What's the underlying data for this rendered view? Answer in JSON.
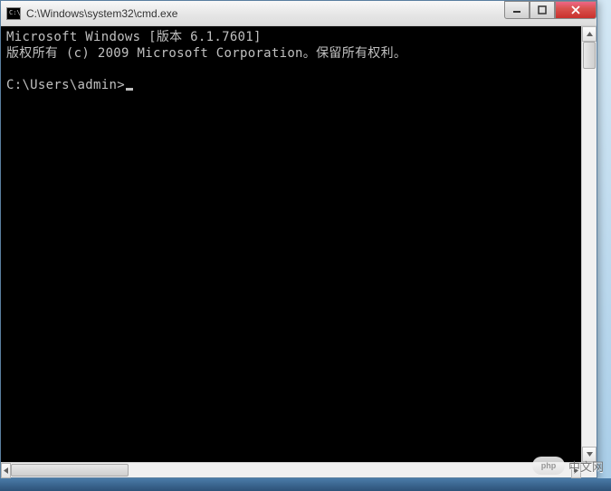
{
  "window": {
    "title": "C:\\Windows\\system32\\cmd.exe",
    "icon_label": "C:\\"
  },
  "console": {
    "line1": "Microsoft Windows [版本 6.1.7601]",
    "line2": "版权所有 (c) 2009 Microsoft Corporation。保留所有权利。",
    "blank": "",
    "prompt": "C:\\Users\\admin>"
  },
  "watermark": {
    "logo": "php",
    "text": "中文网"
  },
  "icons": {
    "minimize": "minimize-icon",
    "maximize": "maximize-icon",
    "close": "close-icon",
    "arrow_up": "arrow-up-icon",
    "arrow_down": "arrow-down-icon",
    "arrow_left": "arrow-left-icon",
    "arrow_right": "arrow-right-icon"
  }
}
